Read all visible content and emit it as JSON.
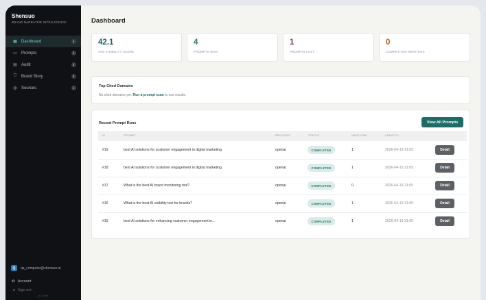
{
  "brand": {
    "name": "Shensuo",
    "tagline": "Brand Narrative Intelligence"
  },
  "nav": [
    {
      "label": "Dashboard",
      "icon": "dashboard-icon",
      "glyph": "▦",
      "active": true
    },
    {
      "label": "Prompts",
      "icon": "chat-icon",
      "glyph": "▭",
      "active": false
    },
    {
      "label": "Audit",
      "icon": "audit-icon",
      "glyph": "▤",
      "active": false
    },
    {
      "label": "Brand Story",
      "icon": "shield-icon",
      "glyph": "⛉",
      "active": false
    },
    {
      "label": "Sources",
      "icon": "globe-icon",
      "glyph": "◍",
      "active": false
    }
  ],
  "info_badge": "i",
  "user": {
    "initial": "Q",
    "email": "qa_computer@shensuo.ai"
  },
  "account_label": "Account",
  "signout_label": "Sign out",
  "version": "v0.1 beta",
  "page_title": "Dashboard",
  "stats": [
    {
      "value": "42.1",
      "label": "Avg Visibility Score",
      "color": "#1e5d64"
    },
    {
      "value": "4",
      "label": "Prompts Won",
      "color": "#2e7d4f"
    },
    {
      "value": "1",
      "label": "Prompts Lost",
      "color": "#8b2f6b"
    },
    {
      "value": "0",
      "label": "Competitor Mentions",
      "color": "#b45a1f"
    }
  ],
  "domains": {
    "title": "Top Cited Domains",
    "text_before": "No cited domains yet. ",
    "link": "Run a prompt scan",
    "text_after": " to see results."
  },
  "runs": {
    "title": "Recent Prompt Runs",
    "view_all": "View All Prompts",
    "columns": [
      "ID",
      "Prompt",
      "Provider",
      "Status",
      "Mentions",
      "Created"
    ],
    "rows": [
      {
        "id": "#19",
        "prompt": "best AI solutions for customer engagement in digital marketing",
        "provider": "openai",
        "status": "COMPLETED",
        "mentions": "1",
        "created": "2026-04-19 21:05",
        "action": "Detail"
      },
      {
        "id": "#18",
        "prompt": "best AI solutions for customer engagement in digital marketing",
        "provider": "openai",
        "status": "COMPLETED",
        "mentions": "1",
        "created": "2026-04-19 21:05",
        "action": "Detail"
      },
      {
        "id": "#17",
        "prompt": "What is the best AI brand monitoring tool?",
        "provider": "openai",
        "status": "COMPLETED",
        "mentions": "0",
        "created": "2026-04-19 21:05",
        "action": "Detail"
      },
      {
        "id": "#16",
        "prompt": "What is the best AI visibility tool for brands?",
        "provider": "openai",
        "status": "COMPLETED",
        "mentions": "1",
        "created": "2026-04-19 21:05",
        "action": "Detail"
      },
      {
        "id": "#15",
        "prompt": "best AI solutions for enhancing customer engagement in...",
        "provider": "openai",
        "status": "COMPLETED",
        "mentions": "1",
        "created": "2026-04-19 21:05",
        "action": "Detail"
      }
    ]
  }
}
